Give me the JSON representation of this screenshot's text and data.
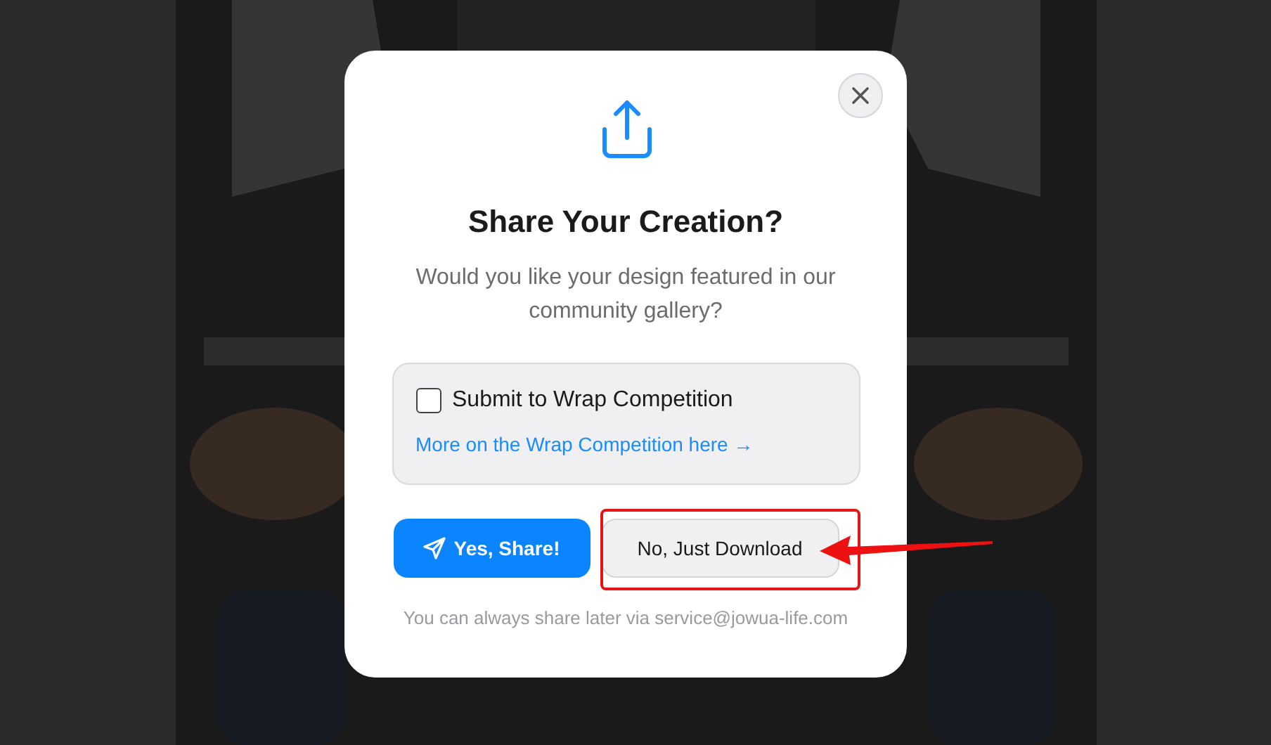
{
  "dialog": {
    "title": "Share Your Creation?",
    "message": "Would you like your design featured in our community gallery?",
    "option": {
      "label": "Submit to Wrap Competition",
      "checked": false
    },
    "link": "More on the Wrap Competition here →",
    "buttons": [
      {
        "label": "Yes, Share!",
        "kind": "primary"
      },
      {
        "label": "No, Just Download",
        "kind": "secondary"
      }
    ],
    "footer": "You can always share later via service@jowua-life.com"
  },
  "annotations": [
    {
      "kind": "box"
    },
    {
      "kind": "arrow"
    }
  ]
}
